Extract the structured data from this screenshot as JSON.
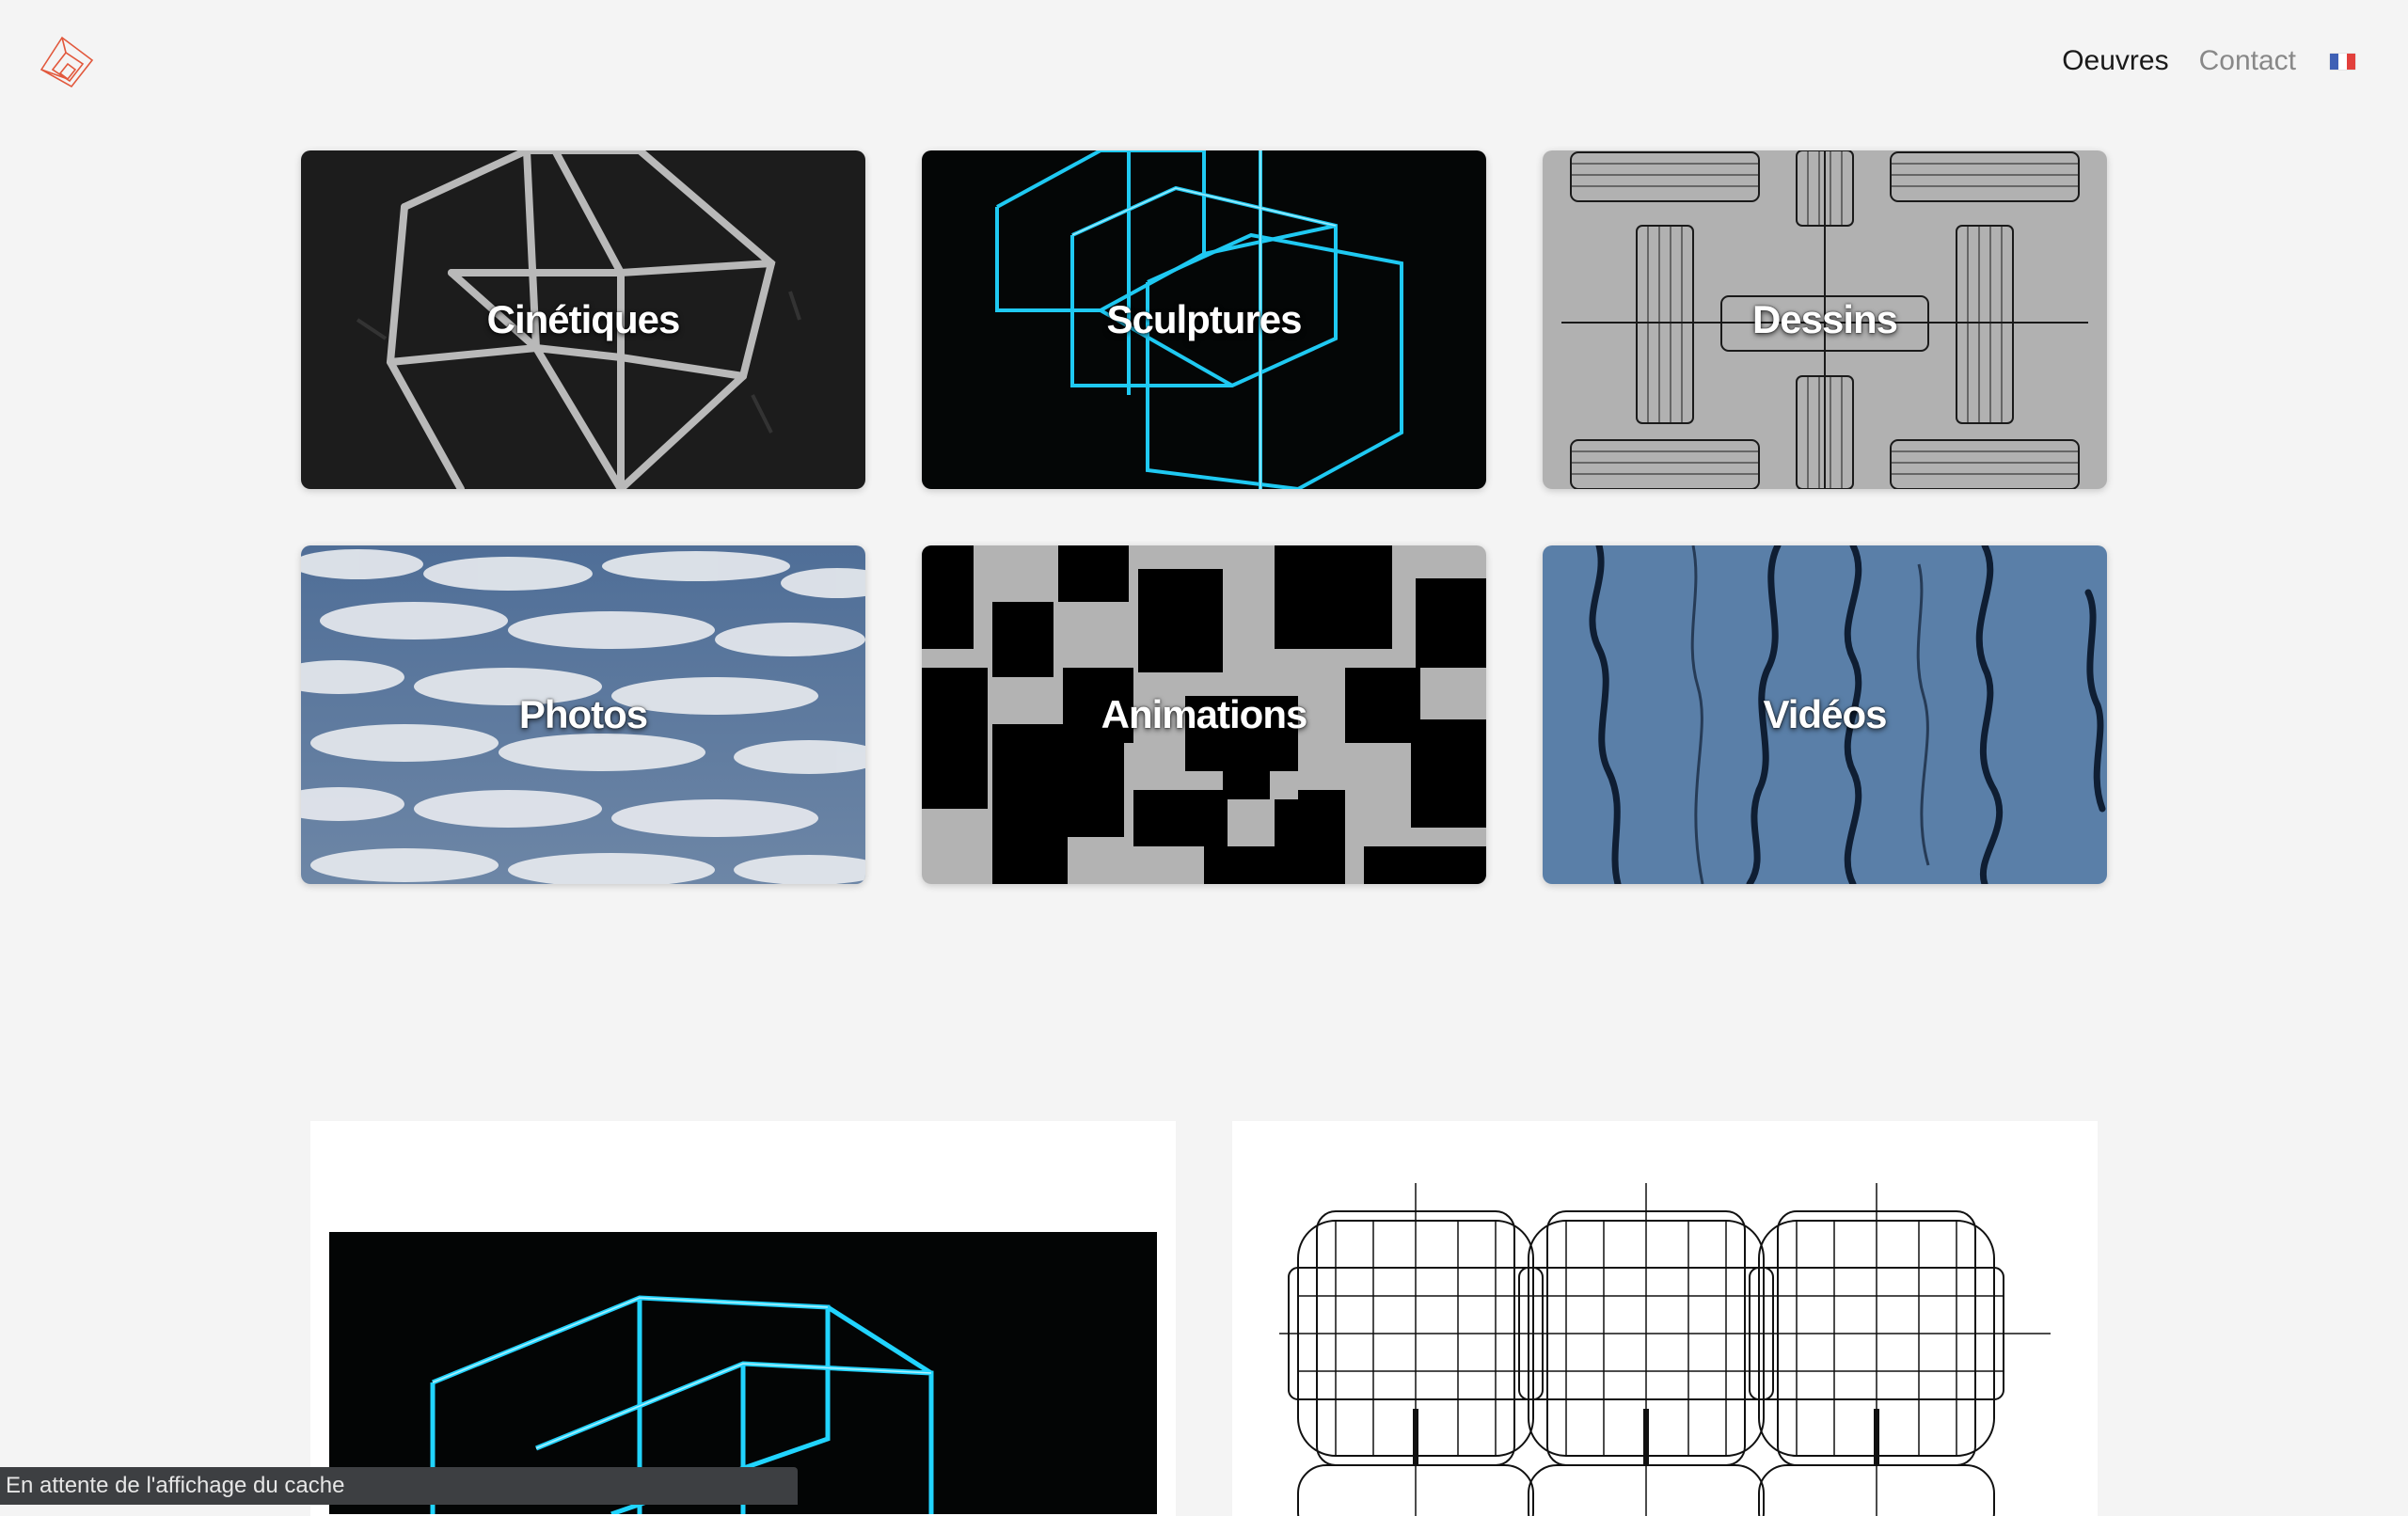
{
  "header": {
    "logo": "geometric-logo-icon",
    "nav": [
      {
        "label": "Oeuvres",
        "active": true
      },
      {
        "label": "Contact",
        "active": false
      }
    ],
    "language_flag": {
      "icon": "french-flag-icon",
      "colors": [
        "#3f60b5",
        "#ffffff",
        "#e2403c"
      ]
    }
  },
  "categories": [
    {
      "label": "Cinétiques",
      "image": "kinetic-wire-sculpture"
    },
    {
      "label": "Sculptures",
      "image": "blue-neon-cube"
    },
    {
      "label": "Dessins",
      "image": "line-drawing-cylinders"
    },
    {
      "label": "Photos",
      "image": "cloud-sky"
    },
    {
      "label": "Animations",
      "image": "black-grey-squares"
    },
    {
      "label": "Vidéos",
      "image": "blue-water-reflection"
    }
  ],
  "featured": [
    {
      "image": "blue-neon-cube"
    },
    {
      "image": "line-drawing-grid"
    }
  ],
  "status_bar": {
    "text": "En attente de l'affichage du cache"
  },
  "colors": {
    "background": "#f4f4f4",
    "logo": "#e2583c",
    "neon": "#21d4ff"
  }
}
